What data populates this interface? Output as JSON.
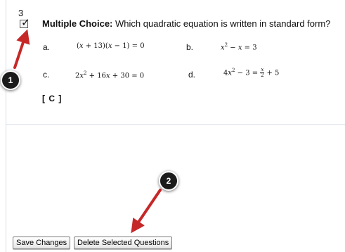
{
  "question": {
    "number": "3",
    "checked": true,
    "type_label": "Multiple Choice:",
    "prompt": "Which quadratic equation is written in standard form?",
    "choices": [
      {
        "letter": "a.",
        "equation": "(x + 13)(x − 1) = 0"
      },
      {
        "letter": "b.",
        "equation": "x² − x = 3"
      },
      {
        "letter": "c.",
        "equation": "2x² + 16x + 30 = 0"
      },
      {
        "letter": "d.",
        "equation": "4x² − 3 = x/2 + 5"
      }
    ],
    "answer": "[ C ]"
  },
  "buttons": {
    "save_label": "Save Changes",
    "delete_label": "Delete Selected Questions"
  },
  "annotations": {
    "badge_1": "1",
    "badge_2": "2",
    "arrow_color": "#c62828",
    "badge_color": "#1b1b1b"
  }
}
